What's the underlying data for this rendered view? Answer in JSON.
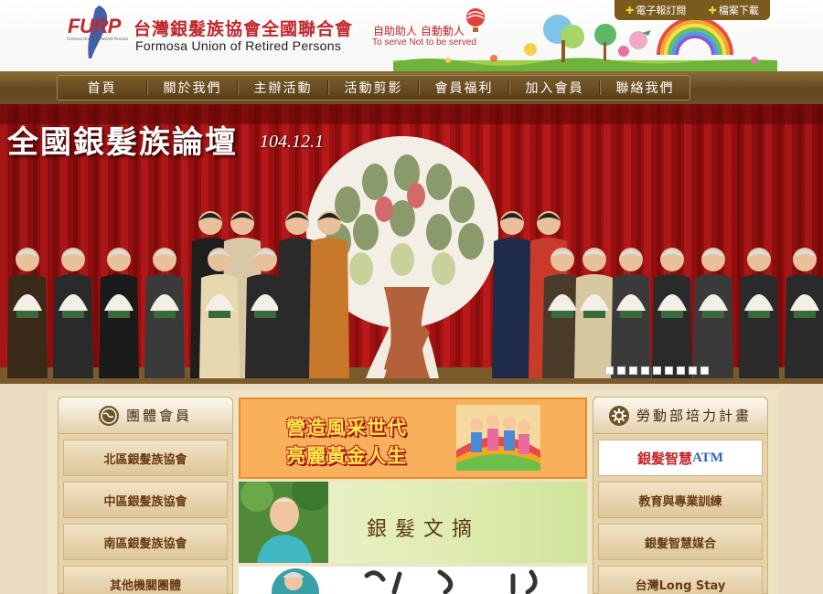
{
  "header": {
    "logo_text": "FURP",
    "logo_small": "Formosa Union of Retired Persons",
    "org_name_zh": "台灣銀髮族協會全國聯合會",
    "org_name_en": "Formosa Union of Retired Persons",
    "slogan_zh": "自助助人 自動動人",
    "slogan_en": "To serve Not to be served"
  },
  "util_links": [
    {
      "label": "電子報訂閱",
      "icon": "plus-icon"
    },
    {
      "label": "檔案下載",
      "icon": "plus-icon"
    }
  ],
  "nav": [
    "首頁",
    "關於我們",
    "主辦活動",
    "活動剪影",
    "會員福利",
    "加入會員",
    "聯絡我們"
  ],
  "banner": {
    "title": "全國銀髮族論壇",
    "date": "104.12.1",
    "slide_count": 9
  },
  "left_panel": {
    "title": "團體會員",
    "icon": "globe-icon",
    "items": [
      "北區銀髮族協會",
      "中區銀髮族協會",
      "南區銀髮族協會",
      "其他機關團體"
    ]
  },
  "center": {
    "ad1_line1": "營造風采世代",
    "ad1_line2": "亮麗黃金人生",
    "ad2_text": "銀髮文摘"
  },
  "right_panel": {
    "title": "勞動部培力計畫",
    "icon": "gear-icon",
    "atm_zh": "銀髮智慧",
    "atm_en": "ATM",
    "items": [
      "教育與專業訓練",
      "銀髮智慧媒合",
      "台灣Long Stay"
    ]
  },
  "colors": {
    "brand_red": "#c1272d",
    "nav_brown": "#5e4520",
    "panel_text": "#6a3b12"
  }
}
